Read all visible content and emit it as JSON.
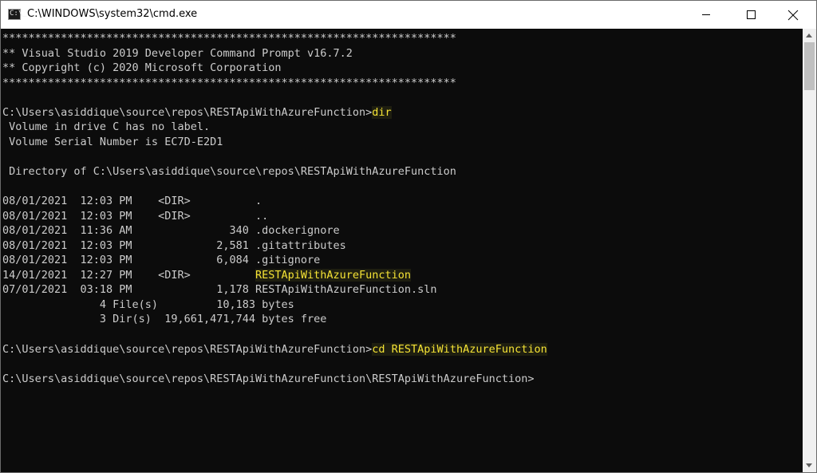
{
  "window": {
    "title": "C:\\WINDOWS\\system32\\cmd.exe",
    "icon": "cmd-icon",
    "icon_glyph": "C:\\_"
  },
  "console": {
    "lines": [
      {
        "text": "**********************************************************************"
      },
      {
        "text": "** Visual Studio 2019 Developer Command Prompt v16.7.2"
      },
      {
        "text": "** Copyright (c) 2020 Microsoft Corporation"
      },
      {
        "text": "**********************************************************************"
      },
      {
        "text": ""
      },
      {
        "text": "C:\\Users\\asiddique\\source\\repos\\RESTApiWithAzureFunction>",
        "hl": "dir"
      },
      {
        "text": " Volume in drive C has no label."
      },
      {
        "text": " Volume Serial Number is EC7D-E2D1"
      },
      {
        "text": ""
      },
      {
        "text": " Directory of C:\\Users\\asiddique\\source\\repos\\RESTApiWithAzureFunction"
      },
      {
        "text": ""
      },
      {
        "text": "08/01/2021  12:03 PM    <DIR>          ."
      },
      {
        "text": "08/01/2021  12:03 PM    <DIR>          .."
      },
      {
        "text": "08/01/2021  11:36 AM               340 .dockerignore"
      },
      {
        "text": "08/01/2021  12:03 PM             2,581 .gitattributes"
      },
      {
        "text": "08/01/2021  12:03 PM             6,084 .gitignore"
      },
      {
        "text": "14/01/2021  12:27 PM    <DIR>          ",
        "hl": "RESTApiWithAzureFunction"
      },
      {
        "text": "07/01/2021  03:18 PM             1,178 RESTApiWithAzureFunction.sln"
      },
      {
        "text": "               4 File(s)         10,183 bytes"
      },
      {
        "text": "               3 Dir(s)  19,661,471,744 bytes free"
      },
      {
        "text": ""
      },
      {
        "text": "C:\\Users\\asiddique\\source\\repos\\RESTApiWithAzureFunction>",
        "hl": "cd RESTApiWithAzureFunction"
      },
      {
        "text": ""
      },
      {
        "text": "C:\\Users\\asiddique\\source\\repos\\RESTApiWithAzureFunction\\RESTApiWithAzureFunction>"
      }
    ]
  },
  "colors": {
    "background": "#0c0c0c",
    "text": "#cccccc",
    "highlight": "#f5e335"
  }
}
